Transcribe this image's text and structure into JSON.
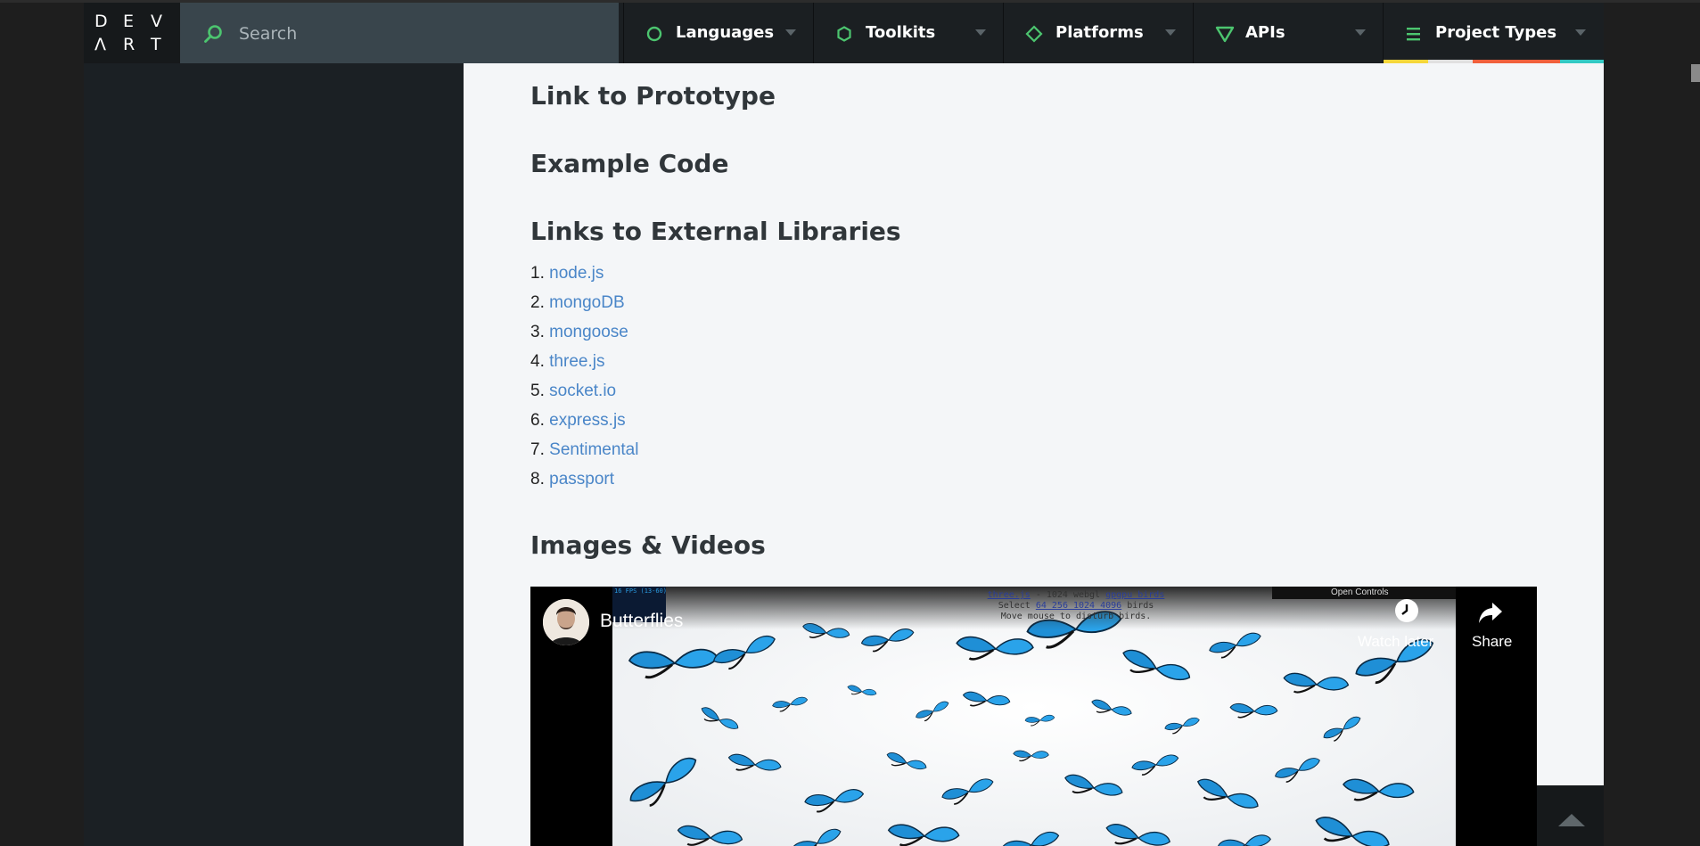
{
  "logo": {
    "row1": [
      "D",
      "E",
      "V"
    ],
    "row2": [
      "Λ",
      "R",
      "T"
    ]
  },
  "search": {
    "placeholder": "Search"
  },
  "nav": {
    "tabs": [
      {
        "label": "Languages",
        "icon": "circle-icon",
        "color": "#4cc56f"
      },
      {
        "label": "Toolkits",
        "icon": "hexagon-icon",
        "color": "#4cc56f"
      },
      {
        "label": "Platforms",
        "icon": "diamond-icon",
        "color": "#4cc56f"
      },
      {
        "label": "APIs",
        "icon": "triangle-down-icon",
        "color": "#4cc56f"
      },
      {
        "label": "Project Types",
        "icon": "list-icon",
        "color": "#4cc56f"
      }
    ],
    "accent_colors": [
      "#f5d63a",
      "#e0e0e0",
      "#f0603c",
      "#33c9c4"
    ]
  },
  "content": {
    "headings": {
      "prototype": "Link to Prototype",
      "example_code": "Example Code",
      "external_libraries": "Links to External Libraries",
      "images_videos": "Images & Videos"
    },
    "libraries": [
      {
        "num": "1.",
        "label": "node.js"
      },
      {
        "num": "2.",
        "label": "mongoDB"
      },
      {
        "num": "3.",
        "label": "mongoose"
      },
      {
        "num": "4.",
        "label": "three.js"
      },
      {
        "num": "5.",
        "label": "socket.io"
      },
      {
        "num": "6.",
        "label": "express.js"
      },
      {
        "num": "7.",
        "label": "Sentimental"
      },
      {
        "num": "8.",
        "label": "passport"
      }
    ],
    "link_color": "#4a86c8"
  },
  "video": {
    "title": "Butterflies",
    "watch_later": "Watch later",
    "share": "Share",
    "open_controls": "Open Controls",
    "fps": "16 FPS (13-60)",
    "overlay_line1_link": "three.js",
    "overlay_line1_rest": " - 1024 webgl ",
    "overlay_line1_link2": "gpgpu birds",
    "overlay_line2_start": "Select ",
    "overlay_line2_links": "64 256 1024 4096",
    "overlay_line2_end": " birds",
    "overlay_line3": "Move mouse to disturb birds."
  }
}
